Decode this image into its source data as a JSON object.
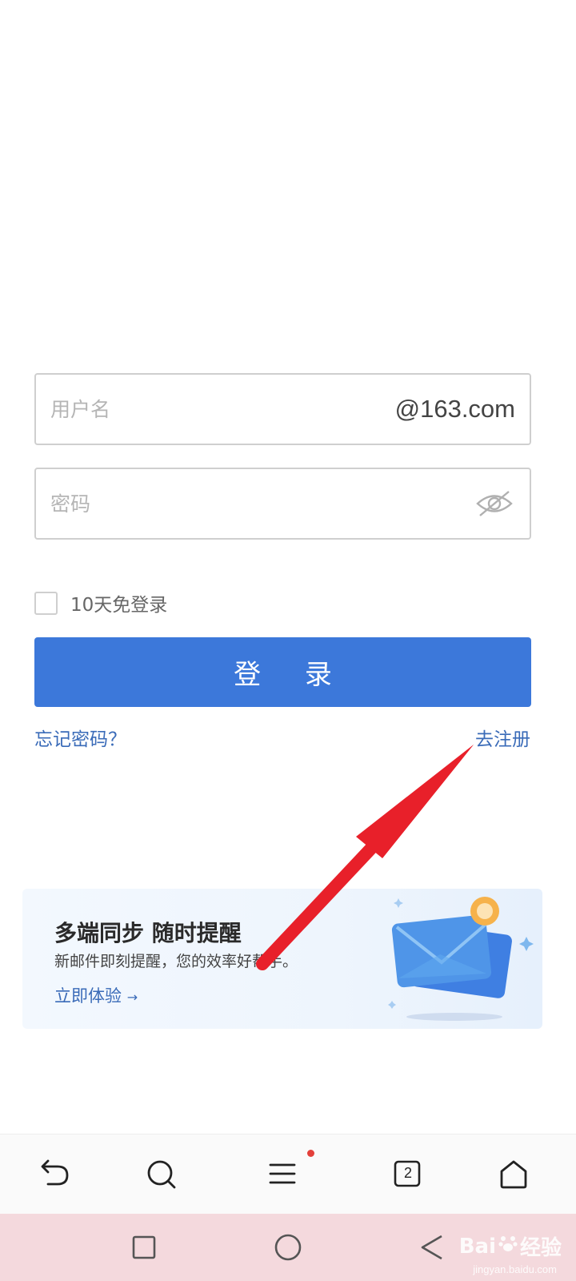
{
  "login_form": {
    "username_placeholder": "用户名",
    "domain_suffix": "@163.com",
    "password_placeholder": "密码",
    "remember_label": "10天免登录",
    "remember_checked": false,
    "login_button": "登 录",
    "forgot_password": "忘记密码？",
    "register": "去注册"
  },
  "promo_banner": {
    "title": "多端同步 随时提醒",
    "subtitle": "新邮件即刻提醒，您的效率好帮手。",
    "cta": "立即体验"
  },
  "browser_toolbar": {
    "items": [
      "back-icon",
      "search-icon",
      "menu-icon",
      "tabs-icon",
      "home-icon"
    ],
    "tab_count": "2",
    "menu_badge_color": "#e3403a"
  },
  "system_nav": {
    "items": [
      "recents-icon",
      "home-circle-icon",
      "back-triangle-icon"
    ]
  },
  "watermark": {
    "brand": "Bai",
    "brand2": "经验",
    "url": "jingyan.baidu.com"
  },
  "colors": {
    "primary": "#3c78da",
    "link": "#3a6bb8",
    "annotation_arrow": "#e8202a"
  }
}
